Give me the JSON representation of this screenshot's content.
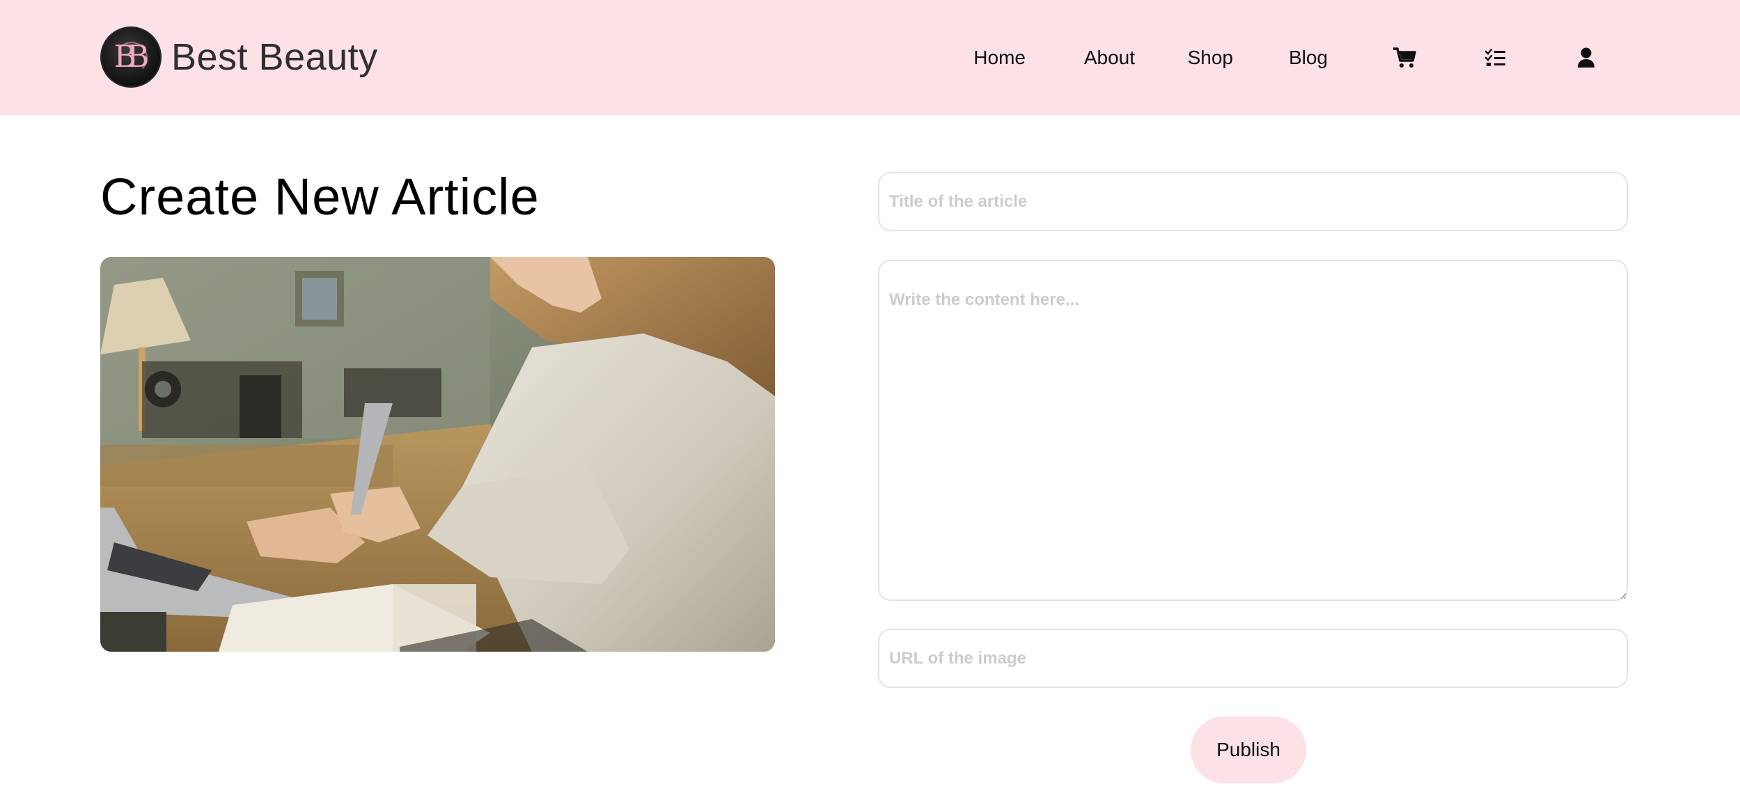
{
  "brand": {
    "name": "Best Beauty",
    "logo_text": "BB"
  },
  "nav": {
    "items": [
      {
        "label": "Home"
      },
      {
        "label": "About"
      },
      {
        "label": "Shop"
      },
      {
        "label": "Blog"
      }
    ],
    "icons": [
      "cart-icon",
      "checklist-icon",
      "user-icon"
    ]
  },
  "page": {
    "title": "Create New Article"
  },
  "form": {
    "title_placeholder": "Title of the article",
    "content_placeholder": "Write the content here...",
    "url_placeholder": "URL of the image",
    "publish_label": "Publish"
  },
  "colors": {
    "header_bg": "#fce1e6",
    "button_bg": "#fce1e6",
    "logo_accent": "#f1a7bb"
  }
}
